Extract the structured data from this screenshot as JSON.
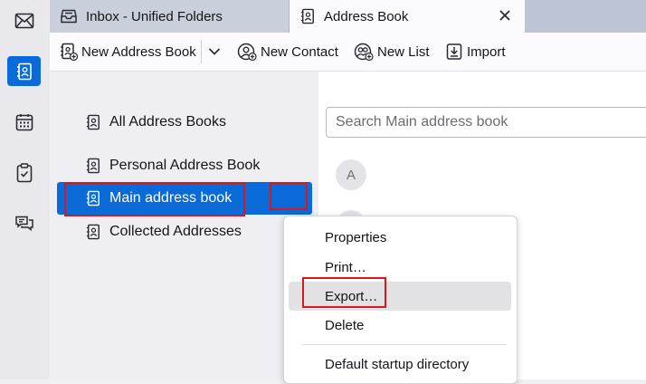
{
  "tabs": [
    {
      "label": "Inbox - Unified Folders",
      "icon": "inbox-tray-icon"
    },
    {
      "label": "Address Book",
      "icon": "address-book-icon",
      "close_icon": "close-icon"
    }
  ],
  "toolbar": {
    "new_address_book": "New Address Book",
    "new_contact": "New Contact",
    "new_list": "New List",
    "import": "Import"
  },
  "spaces": [
    "mail-icon",
    "address-book-icon",
    "calendar-icon",
    "tasks-icon",
    "chat-icon"
  ],
  "books": [
    {
      "label": "All Address Books",
      "selected": false
    },
    {
      "label": "Personal Address Book",
      "selected": false
    },
    {
      "label": "Main address book",
      "selected": true
    },
    {
      "label": "Collected Addresses",
      "selected": false
    }
  ],
  "search": {
    "placeholder": "Search Main address book"
  },
  "cards": [
    {
      "initial": "A"
    }
  ],
  "context_menu": {
    "items": [
      "Properties",
      "Print…",
      "Export…",
      "Delete",
      "Default startup directory"
    ],
    "hover_item": "Export…"
  },
  "colors": {
    "accent": "#0a6ad8",
    "highlight": "#d7191e"
  }
}
